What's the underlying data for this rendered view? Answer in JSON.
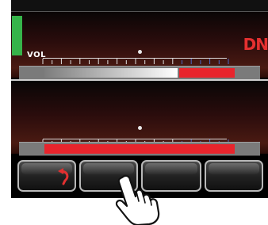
{
  "upper_panel": {
    "volume_label": "VOL",
    "mode_indicator": "DN",
    "level_meter_color": "#36b44a",
    "volume_fill_fraction": 0.71,
    "red_segment_fraction": 0.23
  },
  "lower_panel": {
    "red_fill_fraction": 0.94
  },
  "soft_keys": [
    {
      "name": "soft-key-1",
      "icon": "back-arrow-icon"
    },
    {
      "name": "soft-key-2",
      "icon": ""
    },
    {
      "name": "soft-key-3",
      "icon": ""
    },
    {
      "name": "soft-key-4",
      "icon": ""
    }
  ],
  "colors": {
    "accent_red": "#e8242c",
    "tick_blue": "#4a66c8",
    "mode_text": "#e53030"
  },
  "gesture": {
    "icon": "tap-hand-icon",
    "target": "soft-key-2"
  }
}
